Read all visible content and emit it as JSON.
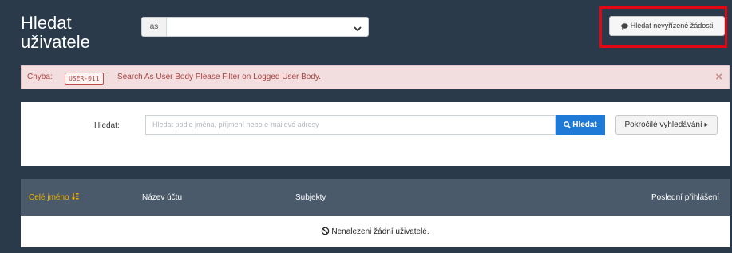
{
  "header": {
    "title": "Hledat uživatele",
    "as_select": {
      "prefix": "as",
      "value": ""
    },
    "pending_button_label": "Hledat nevyřízené žádosti"
  },
  "error": {
    "label": "Chyba:",
    "code": "USER-011",
    "message": "Search As User Body   Please Filter on Logged User Body.",
    "close_glyph": "×"
  },
  "search": {
    "label": "Hledat:",
    "placeholder": "Hledat podle jména, příjmení nebo e-mailové adresy",
    "button_label": "Hledat",
    "advanced_label": "Pokročilé vyhledávání ▸"
  },
  "table": {
    "columns": [
      "Celé jméno",
      "Název účtu",
      "Subjekty",
      "Poslední přihlášení"
    ],
    "empty_message": "Nenalezeni žádní uživatelé."
  },
  "colors": {
    "background": "#2b3a4a",
    "table_header": "#4a5a6a",
    "accent_primary": "#1e7ad6",
    "sort_column": "#f0b400",
    "error_bg": "#f2dede",
    "error_text": "#a94442",
    "highlight_box": "#e30613"
  },
  "icons": [
    "comment-icon",
    "search-icon",
    "sort-icon",
    "ban-icon",
    "chevron-down-icon",
    "close-icon"
  ]
}
